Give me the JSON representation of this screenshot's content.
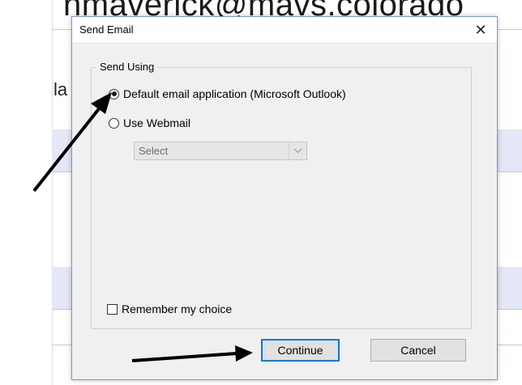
{
  "background": {
    "email_fragment": "nmaverick@mavs.colorado",
    "left_fragment": "la"
  },
  "dialog": {
    "title": "Send Email",
    "close_label": "✕",
    "group": {
      "legend": "Send Using",
      "options": [
        {
          "label": "Default email application (Microsoft Outlook)",
          "checked": true
        },
        {
          "label": "Use Webmail",
          "checked": false
        }
      ],
      "select": {
        "value": "Select",
        "disabled": true
      },
      "remember": {
        "label": "Remember my choice",
        "checked": false
      }
    },
    "buttons": {
      "continue": "Continue",
      "cancel": "Cancel"
    }
  },
  "annotations": {
    "arrow_color": "#000000",
    "count": 2
  }
}
